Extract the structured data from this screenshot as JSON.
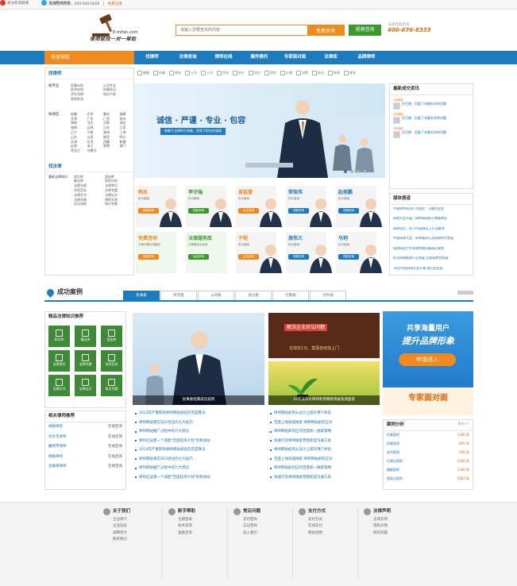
{
  "topbar": {
    "hotline_label": "法律咨询热线：400-000-0000",
    "sep": "|",
    "links": [
      "免费注册"
    ],
    "weibo": "关注新浪微博",
    "tencent": "关注腾讯微博"
  },
  "header": {
    "logo_domain": "E-mifan.com",
    "logo_slogan": "律师就找一对一帮助",
    "search_placeholder": "请输入您要查找的内容",
    "search_button": "免费咨询",
    "video_button": "视频咨询",
    "hotline_title": "法律咨询热线",
    "hotline_number": "400-676-8333"
  },
  "nav": {
    "quick": "快速导航",
    "items": [
      "找律师",
      "法律咨询",
      "律师在线",
      "案件委托",
      "专家面对面",
      "法律库",
      "品牌律师"
    ]
  },
  "sidebar": {
    "find_lawyer": "找律师",
    "by_specialty": {
      "label": "按专业",
      "items": [
        "民事纠纷",
        "公司专长",
        "经济纠纷",
        "刑事诉讼",
        "涉外法律",
        "知识产权",
        "其他综合"
      ]
    },
    "by_region": {
      "label": "按地区",
      "items": [
        "安徽",
        "北京",
        "重庆",
        "福建",
        "甘肃",
        "广东",
        "广西",
        "贵州",
        "海南",
        "河北",
        "河南",
        "湖北",
        "湖南",
        "吉林",
        "江苏",
        "江西",
        "辽宁",
        "宁夏",
        "青海",
        "上海",
        "山东",
        "山西",
        "陕西",
        "四川",
        "天津",
        "台湾",
        "西藏",
        "新疆",
        "云南",
        "浙江",
        "香港",
        "澳门",
        "黑龙江",
        "内蒙古"
      ]
    },
    "find_law": "找法律",
    "law_knowledge": {
      "label": "基础法律知识",
      "items": [
        "知识库",
        "案由库",
        "事业库",
        "案例分析",
        "法律法规",
        "法律常识",
        "合同范本",
        "法律专题",
        "法律文书",
        "法律论文",
        "法律词典",
        "律师文库",
        "诉讼流程",
        "知识专题"
      ]
    }
  },
  "iconrow": [
    "婚姻",
    "刑事",
    "债权",
    "公司",
    "公司",
    "劳动",
    "房产",
    "医疗",
    "保险",
    "交通",
    "消费",
    "拆迁",
    "继承",
    "更多"
  ],
  "banner": {
    "slogan": "诚信 · 严谨 · 专业 · 包容",
    "sub": "做最于法律的引领者，您案子职业的通道"
  },
  "lawyers": [
    {
      "name": "韩凤",
      "city": "杭州普南",
      "button": "视频咨询",
      "color": "#f08a1d"
    },
    {
      "name": "李守瑞",
      "city": "杭州普南",
      "button": "视频咨询",
      "color": "#3a9a2e"
    },
    {
      "name": "曾猛雷",
      "city": "杭州普南",
      "button": "点击咨询",
      "color": "#f08a1d"
    },
    {
      "name": "荣铭伟",
      "city": "杭州普南",
      "button": "视频咨询",
      "color": "#1d7bbf"
    },
    {
      "name": "赵崇鹏",
      "city": "杭州普南",
      "button": "视频咨询",
      "color": "#1d7bbf"
    },
    {
      "name": "免费咨询",
      "city": "法律问题在线解答",
      "button": "我要咨询",
      "color": "#f08a1d"
    },
    {
      "name": "法律服务库",
      "city": "法律服务全免费",
      "button": "免费查询",
      "color": "#3a9a2e"
    },
    {
      "name": "于程",
      "city": "杭州普南",
      "button": "点击咨询",
      "color": "#f08a1d"
    },
    {
      "name": "周伟义",
      "city": "杭州普南",
      "button": "视频咨询",
      "color": "#1d7bbf"
    },
    {
      "name": "马玥",
      "city": "杭州普南",
      "button": "视频咨询",
      "color": "#1d7bbf"
    }
  ],
  "newest": {
    "title": "最新成交资讯",
    "items": [
      {
        "time": "4分钟前",
        "text": "孙百勇：回复了未婚先孕的问题"
      },
      {
        "time": "4分钟前",
        "text": "孙百勇：回复了未婚先孕的问题"
      },
      {
        "time": "4分钟前",
        "text": "孙百勇：回复了未婚先孕的问题"
      }
    ]
  },
  "notice": {
    "title": "媒体报道",
    "items": [
      "中国律师网法行为保存：可靠在这里",
      "网律大会开展：律师网律网入数据增长",
      "网律项目：41.1%选择买入行业解决",
      "中国网律大会：网律服务以及网络时代发展",
      "网律网站工作系统构想出新结论来吧",
      "抓法网律服务行业发展 互联网转型发展",
      "14位中国网律大会开幕 我们在这里"
    ]
  },
  "success": {
    "title": "成功案例",
    "tabs": [
      "民事类",
      "经济类",
      "公司类",
      "诉讼类",
      "行政类",
      "涉外类"
    ]
  },
  "lawbox": {
    "title": "精品法律知识推荐",
    "tiles": [
      "知识库",
      "事业库",
      "案由库",
      "法律常识",
      "法律专题",
      "合同范本",
      "法律文书",
      "法律论文",
      "热点专题"
    ]
  },
  "relbox": {
    "title": "相关律师推荐",
    "items": [
      {
        "name": "杨殿律师",
        "action": "在线咨询"
      },
      {
        "name": "刘文华律师",
        "action": "在线咨询"
      },
      {
        "name": "戴熙宇律师",
        "action": "在线咨询"
      },
      {
        "name": "杨殿律师",
        "action": "在线咨询"
      },
      {
        "name": "沈辰雨律师",
        "action": "在线咨询"
      }
    ]
  },
  "cases": {
    "main_caption": "民事类经典成功案例",
    "promo_title": "解决企业诉讼问题",
    "promo_sub": "在线仅1元，案源自动找上门",
    "sprout_caption": "10年法律大律师利用网络突破案源困境",
    "left_links": [
      "2014年严重影响律师网站排名的百度算法",
      "律师网站落实SEO优化的七大技巧",
      "律师网站推广过程中的六大禁忌",
      "律师应该建一个适配\"百度轻舟计划\"的移动站",
      "2014年严重影响律师网站排名的百度算法",
      "律师网站落实SEO优化的七大技巧",
      "律师网站推广过程中的六大禁忌",
      "律师应该建一个适配\"百度轻舟计划\"的移动站"
    ],
    "right_links": [
      "律师网站如何从设计上提升用户体验",
      "百度上线权威搜索 律师网站如何应对",
      "律师网站如何应对百度统一搜索策略",
      "快速打造律师搜索营销新型沟通工具",
      "律师网站如何从设计上提升用户体验",
      "百度上线权威搜索 律师网站如何应对",
      "律师网站如何应对百度统一搜索策略",
      "快速打造律师搜索营销新型沟通工具"
    ]
  },
  "ad": {
    "line1": "共享海量用户",
    "line2": "提升品牌形象",
    "button": "申请进入",
    "expert": "专家面对面"
  },
  "casebox": {
    "title": "案例分析",
    "more": "更多>>",
    "items": [
      {
        "name": "民事案例",
        "count": "1306 条"
      },
      {
        "name": "刑事案例",
        "count": "865 条"
      },
      {
        "name": "经济案例",
        "count": "599 条"
      },
      {
        "name": "行政法案例",
        "count": "1306 条"
      },
      {
        "name": "婚姻案例",
        "count": "1306 条"
      },
      {
        "name": "国际法案例",
        "count": "1061 条"
      }
    ]
  },
  "footer": [
    {
      "title": "关于我们",
      "items": [
        "企业简介",
        "企业动态",
        "诚聘英才",
        "联系我们"
      ]
    },
    {
      "title": "新手帮助",
      "items": [
        "注册登录",
        "技术支持",
        "金融咨询"
      ]
    },
    {
      "title": "常见问题",
      "items": [
        "支付密码",
        "忘记密码",
        "加入我们"
      ]
    },
    {
      "title": "支付方式",
      "items": [
        "支付方式",
        "在线支付",
        "网站地图"
      ]
    },
    {
      "title": "法律声明",
      "items": [
        "法律支持",
        "隐私声明",
        "新权问题"
      ]
    }
  ]
}
